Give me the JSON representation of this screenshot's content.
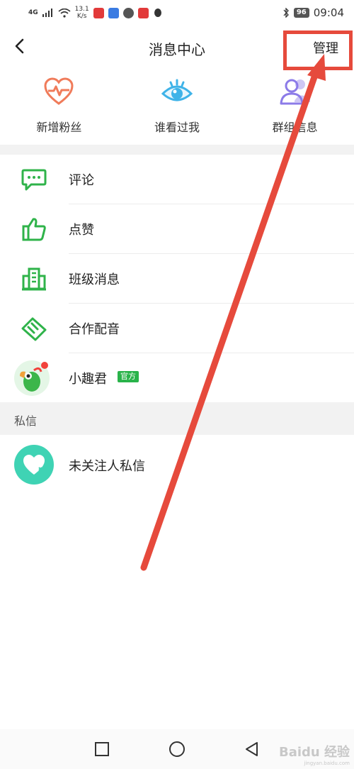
{
  "status_bar": {
    "network": "4G",
    "speed_value": "13.1",
    "speed_unit": "K/s",
    "battery": "96",
    "time": "09:04"
  },
  "header": {
    "title": "消息中心",
    "manage_label": "管理"
  },
  "quick_items": [
    {
      "label": "新增粉丝",
      "icon": "heart-pulse-icon",
      "color": "#f07b5a"
    },
    {
      "label": "谁看过我",
      "icon": "eye-icon",
      "color": "#3fb3e8"
    },
    {
      "label": "群组信息",
      "icon": "group-users-icon",
      "color": "#8c7be8"
    }
  ],
  "list": [
    {
      "label": "评论",
      "icon": "comment-icon"
    },
    {
      "label": "点赞",
      "icon": "thumbs-up-icon"
    },
    {
      "label": "班级消息",
      "icon": "building-icon"
    },
    {
      "label": "合作配音",
      "icon": "handshake-icon"
    },
    {
      "label": "小趣君",
      "icon": "parrot-avatar",
      "badge": "官方"
    }
  ],
  "section": {
    "label": "私信"
  },
  "dm": {
    "label": "未关注人私信",
    "icon": "heart-icon"
  },
  "watermark": {
    "text": "Baidu 经验",
    "sub": "jingyan.baidu.com"
  },
  "colors": {
    "accent_green": "#2fb34a",
    "annotation_red": "#e64a3c",
    "section_bg": "#f2f2f2"
  }
}
